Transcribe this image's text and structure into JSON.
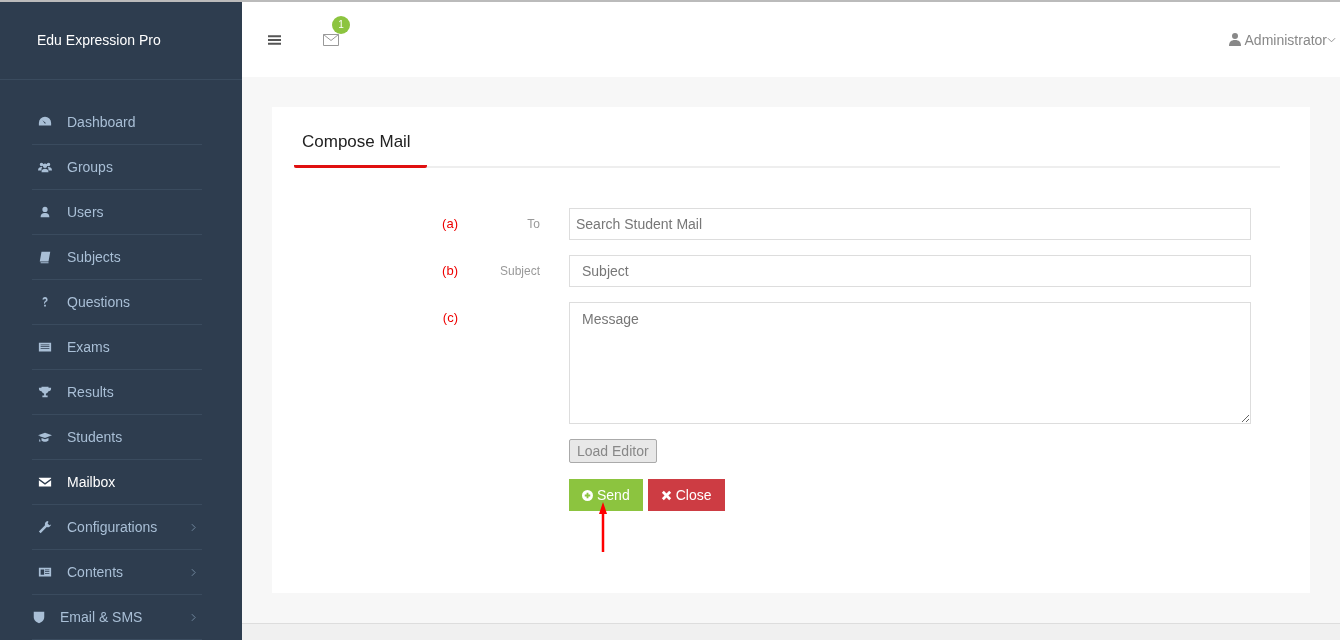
{
  "sidebar": {
    "brand": "Edu Expression Pro",
    "items": [
      {
        "label": "Dashboard",
        "selected": false,
        "expandable": false
      },
      {
        "label": "Groups",
        "selected": false,
        "expandable": false
      },
      {
        "label": "Users",
        "selected": false,
        "expandable": false
      },
      {
        "label": "Subjects",
        "selected": false,
        "expandable": false
      },
      {
        "label": "Questions",
        "selected": false,
        "expandable": false
      },
      {
        "label": "Exams",
        "selected": false,
        "expandable": false
      },
      {
        "label": "Results",
        "selected": false,
        "expandable": false
      },
      {
        "label": "Students",
        "selected": false,
        "expandable": false
      },
      {
        "label": "Mailbox",
        "selected": true,
        "expandable": false
      },
      {
        "label": "Configurations",
        "selected": false,
        "expandable": true
      },
      {
        "label": "Contents",
        "selected": false,
        "expandable": true
      },
      {
        "label": "Email & SMS",
        "selected": false,
        "expandable": true
      }
    ]
  },
  "header": {
    "mail_badge": "1",
    "user": "Administrator"
  },
  "compose": {
    "title": "Compose Mail",
    "fields": [
      {
        "annotation": "(a)",
        "label": "To",
        "placeholder": "Search Student Mail",
        "kind": "input"
      },
      {
        "annotation": "(b)",
        "label": "Subject",
        "placeholder": "Subject",
        "kind": "input"
      },
      {
        "annotation": "(c)",
        "placeholder": "Message",
        "kind": "textarea"
      }
    ],
    "load_editor": "Load Editor",
    "send": "Send",
    "close": "Close"
  }
}
